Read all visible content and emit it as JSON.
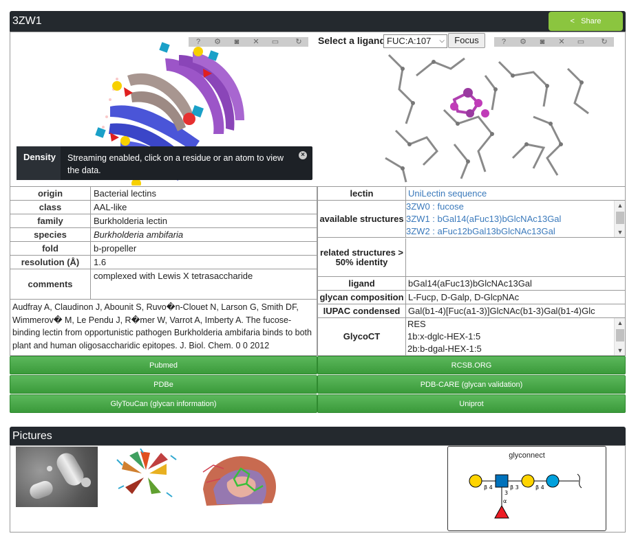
{
  "header": {
    "title": "3ZW1",
    "share_label": "Share"
  },
  "viewer": {
    "select_label": "Select a ligand",
    "select_value": "FUC:A:107",
    "focus_label": "Focus",
    "density_title": "Density",
    "density_text": "Streaming enabled, click on a residue or an atom to view the data.",
    "toolbar_icons": [
      "help-icon",
      "gear-icon",
      "camera-icon",
      "tools-icon",
      "expand-icon",
      "refresh-icon"
    ]
  },
  "left_table": [
    {
      "label": "origin",
      "value": "Bacterial lectins"
    },
    {
      "label": "class",
      "value": "AAL-like"
    },
    {
      "label": "family",
      "value": "Burkholderia lectin"
    },
    {
      "label": "species",
      "value": "Burkholderia ambifaria"
    },
    {
      "label": "fold",
      "value": "b-propeller"
    },
    {
      "label": "resolution (Å)",
      "value": "1.6"
    },
    {
      "label": "comments",
      "value": "complexed with Lewis X tetrasaccharide"
    }
  ],
  "reference": "Audfray A, Claudinon J, Abounit S, Ruvo�n-Clouet N, Larson G, Smith DF, Wimmerov� M, Le Pendu J, R�mer W, Varrot A, Imberty A. The fucose-binding lectin from opportunistic pathogen Burkholderia ambifaria binds to both plant and human oligosaccharidic epitopes. J. Biol. Chem. 0 0 2012",
  "right_table": {
    "lectin_label": "lectin",
    "lectin_value": "UniLectin sequence",
    "avail_label": "available structures",
    "avail_items": [
      "3ZW0 : fucose",
      "3ZW1 : bGal14(aFuc13)bGlcNAc13Gal",
      "3ZW2 : aFuc12bGal13bGlcNAc13Gal"
    ],
    "related_label": "related structures > 50% identity",
    "related_value": "",
    "ligand_label": "ligand",
    "ligand_value": "bGal14(aFuc13)bGlcNAc13Gal",
    "glycan_label": "glycan composition",
    "glycan_value": "L-Fucp, D-Galp, D-GlcpNAc",
    "iupac_label": "IUPAC condensed",
    "iupac_value": "Gal(b1-4)[Fuc(a1-3)]GlcNAc(b1-3)Gal(b1-4)Glc",
    "glycoct_label": "GlycoCT",
    "glycoct_lines": [
      "RES",
      "1b:x-dglc-HEX-1:5",
      "2b:b-dgal-HEX-1:5"
    ]
  },
  "buttons": {
    "pubmed": "Pubmed",
    "rcsb": "RCSB.ORG",
    "pdbe": "PDBe",
    "pdbcare": "PDB-CARE (glycan validation)",
    "glytoucan": "GlyTouCan (glycan information)",
    "uniprot": "Uniprot"
  },
  "pictures": {
    "title": "Pictures",
    "glyconnect_label": "glyconnect",
    "glycan_links": [
      "β 4",
      "β 3",
      "β 4",
      "3",
      "α"
    ]
  }
}
